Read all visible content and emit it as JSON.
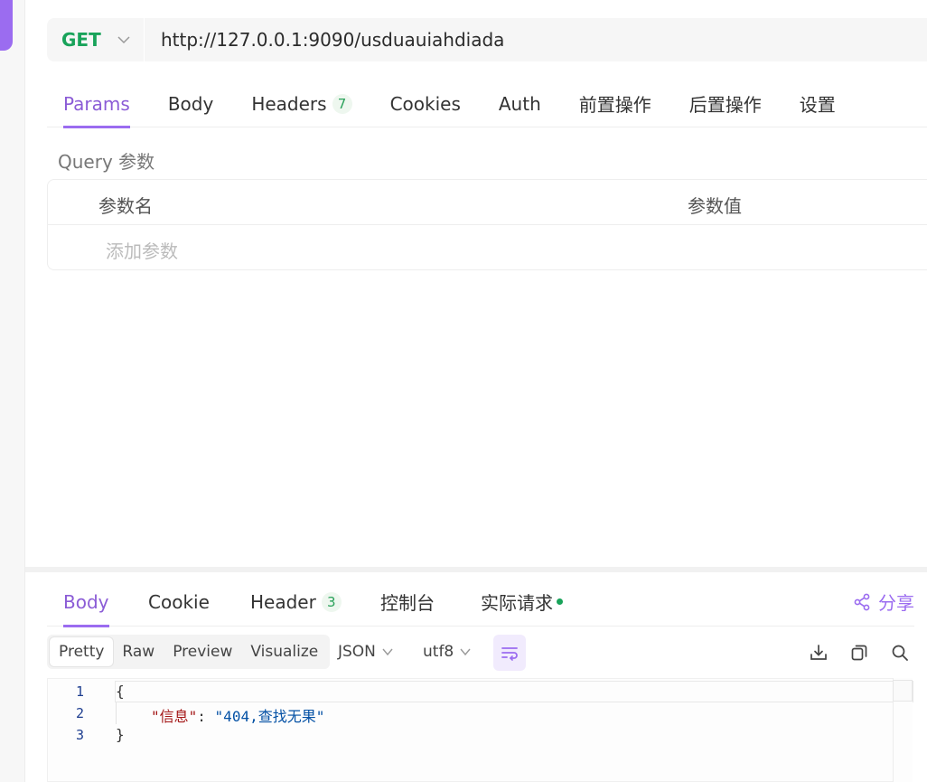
{
  "request": {
    "method": "GET",
    "url": "http://127.0.0.1:9090/usduauiahdiada"
  },
  "request_tabs": [
    {
      "label": "Params",
      "active": true
    },
    {
      "label": "Body"
    },
    {
      "label": "Headers",
      "badge": "7"
    },
    {
      "label": "Cookies"
    },
    {
      "label": "Auth"
    },
    {
      "label": "前置操作"
    },
    {
      "label": "后置操作"
    },
    {
      "label": "设置"
    }
  ],
  "query": {
    "title": "Query 参数",
    "col_name": "参数名",
    "col_value": "参数值",
    "add_placeholder": "添加参数"
  },
  "response_tabs": [
    {
      "label": "Body",
      "active": true
    },
    {
      "label": "Cookie"
    },
    {
      "label": "Header",
      "badge": "3"
    },
    {
      "label": "控制台"
    },
    {
      "label": "实际请求"
    }
  ],
  "share_label": "分享",
  "view_modes": [
    "Pretty",
    "Raw",
    "Preview",
    "Visualize"
  ],
  "format": "JSON",
  "encoding": "utf8",
  "editor": {
    "line_numbers": [
      "1",
      "2",
      "3"
    ],
    "open_brace": "{",
    "key": "\"信息\"",
    "colon": ": ",
    "value": "\"404,查找无果\"",
    "close_brace": "}"
  },
  "colors": {
    "accent": "#9b6cf0",
    "method_get": "#19a35a"
  }
}
